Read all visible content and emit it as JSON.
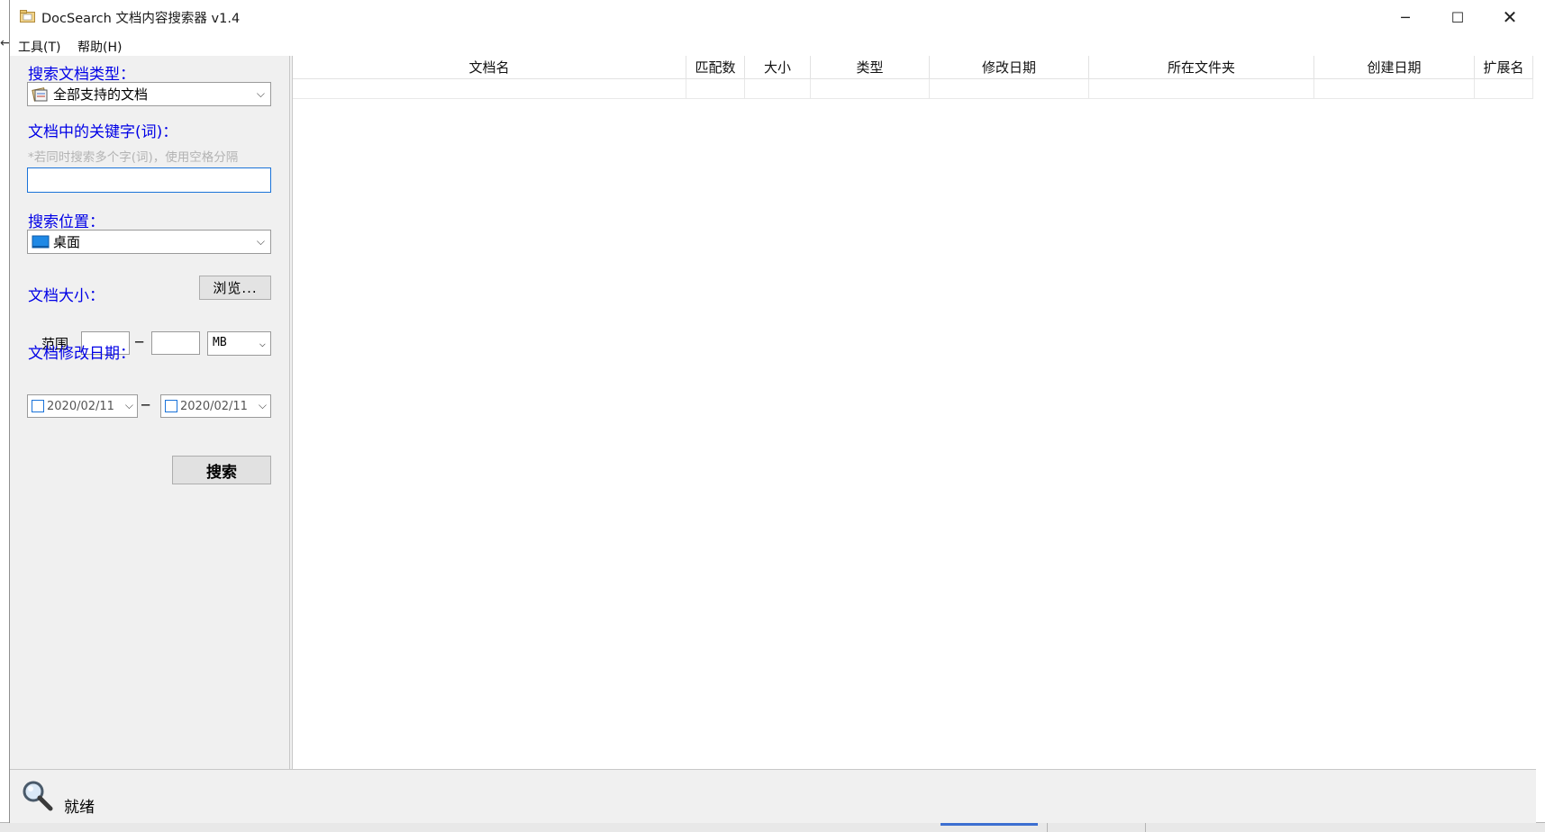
{
  "window": {
    "title": "DocSearch 文档内容搜索器 v1.4",
    "controls": {
      "minimize": "─",
      "maximize": "☐",
      "close": "✕"
    }
  },
  "menu": {
    "items": [
      {
        "label": "工具(T)"
      },
      {
        "label": "帮助(H)"
      }
    ]
  },
  "left_panel": {
    "doc_type": {
      "label": "搜索文档类型：",
      "selected": "全部支持的文档",
      "icon": "documents-stack-icon"
    },
    "keywords": {
      "label": "文档中的关键字(词)：",
      "hint": "*若同时搜索多个字(词)，使用空格分隔",
      "value": ""
    },
    "location": {
      "label": "搜索位置：",
      "selected": "桌面",
      "icon": "desktop-icon",
      "browse_label": "浏览..."
    },
    "size": {
      "label": "文档大小：",
      "range_label": "范围",
      "min": "",
      "max": "",
      "separator": "─",
      "unit": "MB"
    },
    "modified_date": {
      "label": "文档修改日期：",
      "from": "2020/02/11",
      "to": "2020/02/11",
      "separator": "─"
    },
    "search_button": "搜索"
  },
  "results_table": {
    "columns": [
      "文档名",
      "匹配数",
      "大小",
      "类型",
      "修改日期",
      "所在文件夹",
      "创建日期",
      "扩展名"
    ],
    "rows": []
  },
  "status": {
    "text": "就绪",
    "icon": "magnifier-icon"
  },
  "colors": {
    "section_label": "#0000e6",
    "focus_border": "#1a73d9",
    "window_bg": "#f0f0f0"
  }
}
